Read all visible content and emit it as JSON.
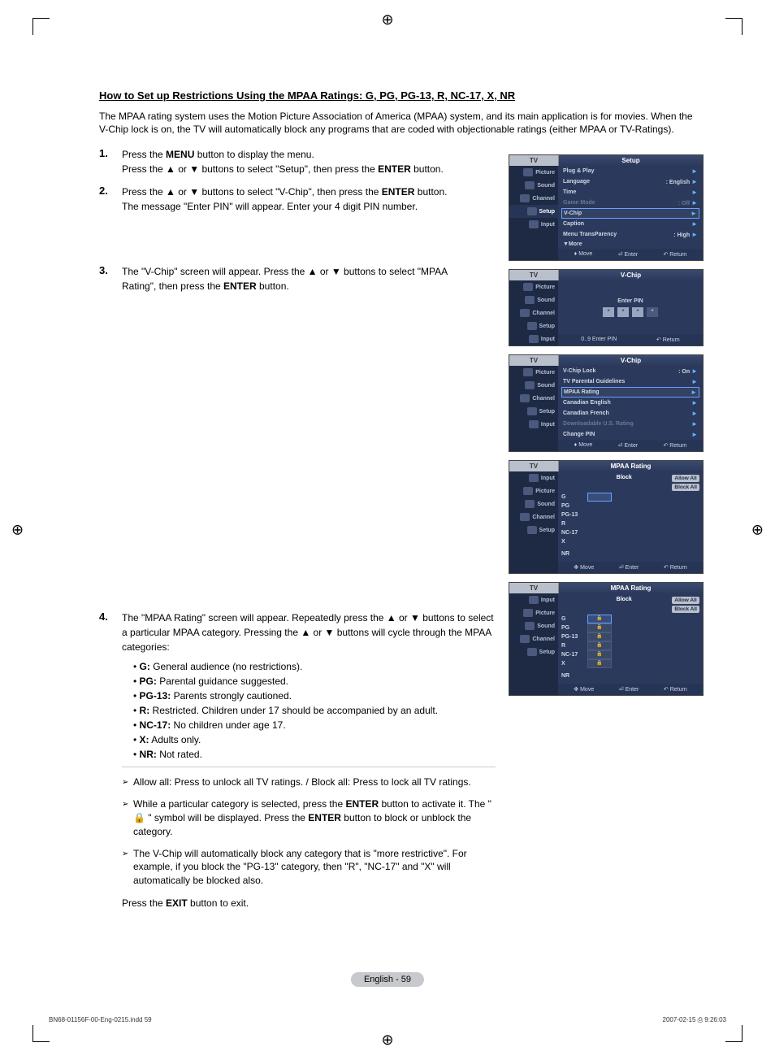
{
  "heading": "How to Set up Restrictions Using the MPAA Ratings: G, PG, PG-13, R, NC-17, X, NR",
  "intro": "The MPAA rating system uses the Motion Picture Association of America (MPAA) system, and its main application is for movies. When the V-Chip lock is on, the TV will automatically block any programs that are coded with objectionable ratings (either MPAA or TV-Ratings).",
  "steps": {
    "s1": {
      "num": "1.",
      "l1a": "Press the ",
      "l1b": "MENU",
      "l1c": " button to display the menu.",
      "l2a": "Press the ▲ or ▼ buttons to select \"Setup\", then press the ",
      "l2b": "ENTER",
      "l2c": " button."
    },
    "s2": {
      "num": "2.",
      "l1a": "Press the ▲ or ▼ buttons to select \"V-Chip\", then press the ",
      "l1b": "ENTER",
      "l1c": " button.",
      "l2": "The message \"Enter PIN\" will appear. Enter your 4 digit PIN number."
    },
    "s3": {
      "num": "3.",
      "l1": "The \"V-Chip\" screen will appear. Press the ▲ or ▼ buttons to select \"MPAA Rating\", then press the ",
      "l1b": "ENTER",
      "l1c": " button."
    },
    "s4": {
      "num": "4.",
      "l1": "The \"MPAA Rating\" screen will appear. Repeatedly press the ▲ or ▼ buttons to select a particular MPAA category. Pressing the ▲ or ▼ buttons will cycle through the MPAA categories:"
    }
  },
  "ratings": {
    "g": {
      "lbl": "G:",
      "txt": " General audience (no restrictions)."
    },
    "pg": {
      "lbl": "PG:",
      "txt": " Parental guidance suggested."
    },
    "pg13": {
      "lbl": "PG-13:",
      "txt": " Parents strongly cautioned."
    },
    "r": {
      "lbl": "R:",
      "txt": " Restricted. Children under 17 should be accompanied by an adult."
    },
    "nc17": {
      "lbl": "NC-17:",
      "txt": " No children under age 17."
    },
    "x": {
      "lbl": "X:",
      "txt": " Adults only."
    },
    "nr": {
      "lbl": "NR:",
      "txt": " Not rated."
    }
  },
  "notes": {
    "n1": "Allow all: Press to unlock all TV ratings. / Block all: Press to lock all TV ratings.",
    "n2a": "While a particular category is selected, press the ",
    "n2b": "ENTER",
    "n2c": " button to activate it. The \" 🔒 \" symbol will be displayed. Press the ",
    "n2d": "ENTER",
    "n2e": " button to block or unblock the category.",
    "n3": "The V-Chip will automatically block any category that is \"more restrictive\". For example, if you block the \"PG-13\" category, then \"R\", \"NC-17\" and \"X\" will automatically be blocked also."
  },
  "exit": {
    "a": "Press the ",
    "b": "EXIT",
    "c": " button to exit."
  },
  "osd": {
    "tv": "TV",
    "side": {
      "picture": "Picture",
      "sound": "Sound",
      "channel": "Channel",
      "setup": "Setup",
      "input": "Input"
    },
    "nav": {
      "move": "Move",
      "enter": "Enter",
      "return": "Return",
      "enterpin": "Enter PIN",
      "updown": "▲▼"
    },
    "setup": {
      "title": "Setup",
      "items": {
        "plug": "Plug & Play",
        "lang": "Language",
        "lang_v": ": English",
        "time": "Time",
        "game": "Game Mode",
        "game_v": ": Off",
        "vchip": "V-Chip",
        "caption": "Caption",
        "trans": "Menu TransParency",
        "trans_v": ": High",
        "more": "▼More"
      }
    },
    "vchip_pin": {
      "title": "V-Chip",
      "enter": "Enter PIN",
      "star": "*"
    },
    "vchip_menu": {
      "title": "V-Chip",
      "lock": "V-Chip Lock",
      "lock_v": ": On",
      "tvpg": "TV Parental Guidelines",
      "mpaa": "MPAA Rating",
      "ce": "Canadian English",
      "cf": "Canadian French",
      "dl": "Downloadable U.S. Rating",
      "cp": "Change PIN"
    },
    "mpaa": {
      "title": "MPAA Rating",
      "block": "Block",
      "allow": "Allow All",
      "blockall": "Block All",
      "g": "G",
      "pg": "PG",
      "pg13": "PG-13",
      "r": "R",
      "nc17": "NC-17",
      "x": "X",
      "nr": "NR"
    }
  },
  "pagefoot": "English - 59",
  "footer": {
    "file": "BN68-01156F-00-Eng-0215.indd   59",
    "date": "2007-02-15   ⎙ 9:26:03"
  }
}
